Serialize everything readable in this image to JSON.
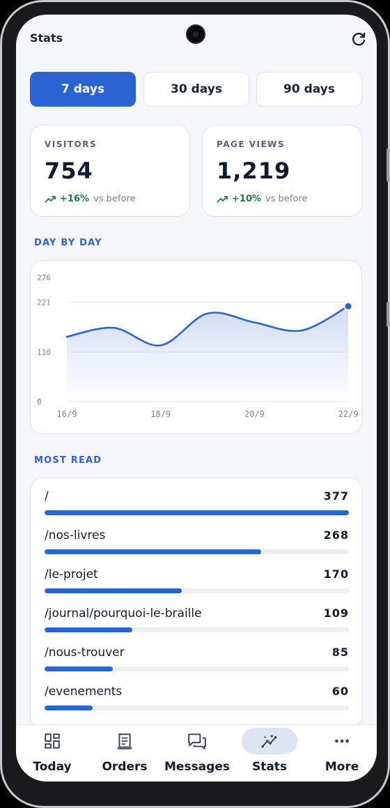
{
  "header": {
    "title": "Stats"
  },
  "range_tabs": [
    {
      "label": "7 days",
      "active": true
    },
    {
      "label": "30 days",
      "active": false
    },
    {
      "label": "90 days",
      "active": false
    }
  ],
  "stats": {
    "visitors": {
      "label": "VISITORS",
      "value": "754",
      "change": "+16%",
      "suffix": "vs before"
    },
    "page_views": {
      "label": "PAGE VIEWS",
      "value": "1,219",
      "change": "+10%",
      "suffix": "vs before"
    }
  },
  "sections": {
    "day_by_day": "DAY BY DAY",
    "most_read": "MOST READ"
  },
  "chart_data": {
    "type": "area",
    "x": [
      "16/9",
      "17/9",
      "18/9",
      "19/9",
      "20/9",
      "21/9",
      "22/9"
    ],
    "values": [
      144,
      164,
      125,
      196,
      176,
      158,
      212
    ],
    "ylim": [
      0,
      276
    ],
    "yticks": [
      0,
      110,
      221,
      276
    ],
    "xticks": [
      "16/9",
      "18/9",
      "20/9",
      "22/9"
    ],
    "grid": true,
    "accent": "#2a63d4"
  },
  "most_read": [
    {
      "path": "/",
      "count": "377",
      "fraction": 1.0
    },
    {
      "path": "/nos-livres",
      "count": "268",
      "fraction": 0.711
    },
    {
      "path": "/le-projet",
      "count": "170",
      "fraction": 0.451
    },
    {
      "path": "/journal/pourquoi-le-braille",
      "count": "109",
      "fraction": 0.289
    },
    {
      "path": "/nous-trouver",
      "count": "85",
      "fraction": 0.225
    },
    {
      "path": "/evenements",
      "count": "60",
      "fraction": 0.159
    }
  ],
  "nav": [
    {
      "label": "Today",
      "icon": "dashboard-icon",
      "active": false
    },
    {
      "label": "Orders",
      "icon": "receipt-icon",
      "active": false
    },
    {
      "label": "Messages",
      "icon": "chat-icon",
      "active": false
    },
    {
      "label": "Stats",
      "icon": "insights-icon",
      "active": true
    },
    {
      "label": "More",
      "icon": "more-dots-icon",
      "active": false
    }
  ],
  "colors": {
    "accent": "#2a63d4",
    "positive": "#1f7a45"
  }
}
